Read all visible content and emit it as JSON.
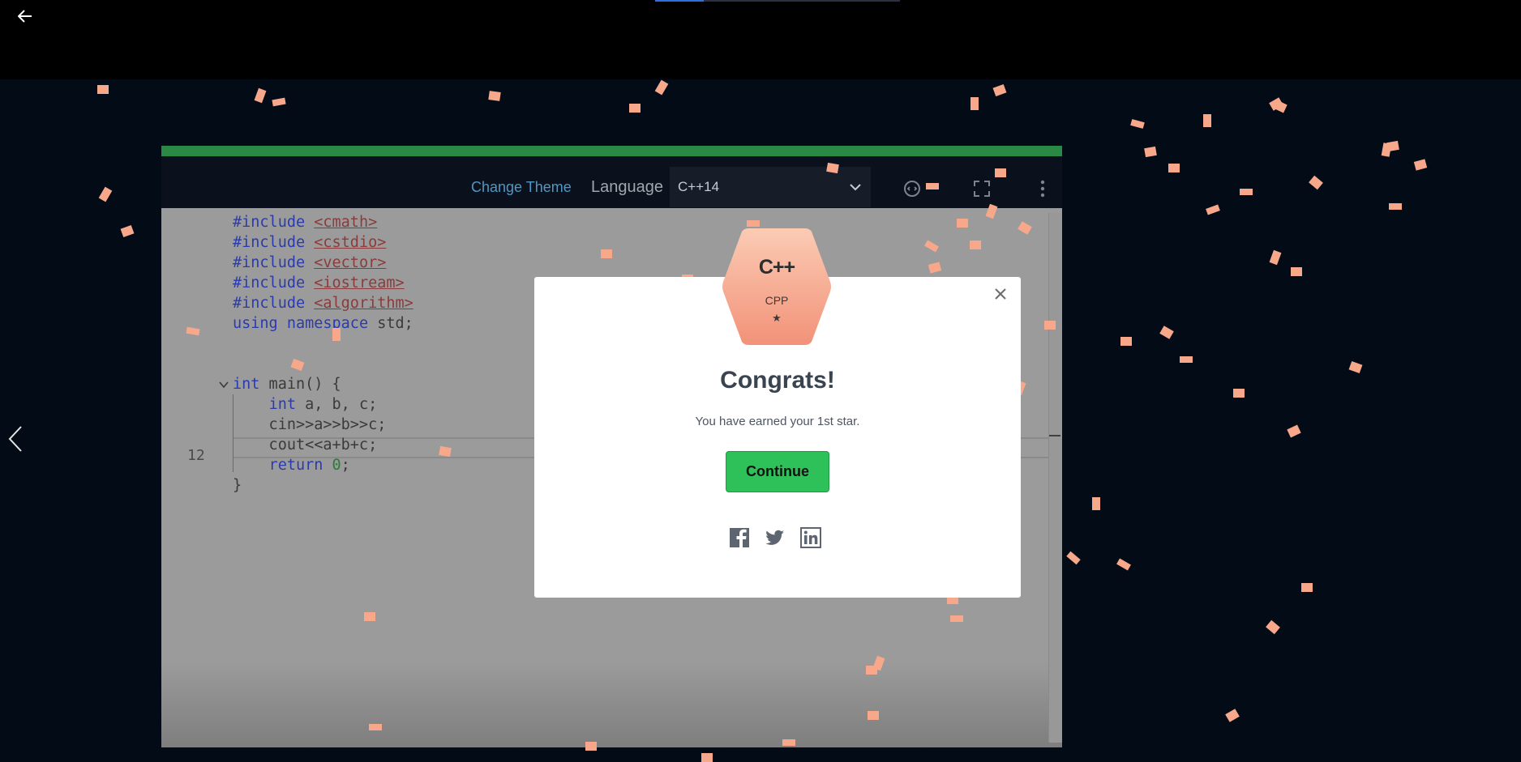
{
  "nav": {
    "back_icon": "arrow-left-icon",
    "prev_icon": "chevron-left-icon",
    "lesson_progress_fraction": 0.2
  },
  "toolbar": {
    "change_theme": "Change Theme",
    "language_label": "Language",
    "language_value": "C++14",
    "icons": [
      "reset-icon",
      "fullscreen-icon",
      "more-vertical-icon"
    ]
  },
  "editor": {
    "current_line_number": "12",
    "code_lines": [
      "#include <cmath>",
      "#include <cstdio>",
      "#include <vector>",
      "#include <iostream>",
      "#include <algorithm>",
      "using namespace std;",
      "",
      "int main() {",
      "    int a, b, c;",
      "    cin>>a>>b>>c;",
      "    cout<<a+b+c;",
      "    return 0;",
      "}"
    ]
  },
  "dialog": {
    "badge_logo": "C++",
    "badge_name": "CPP",
    "badge_star": "★",
    "title": "Congrats!",
    "message": "You have earned your 1st star.",
    "continue_label": "Continue",
    "share_icons": [
      "facebook-icon",
      "twitter-icon",
      "linkedin-icon"
    ]
  },
  "colors": {
    "accent_green": "#2ec15a",
    "progress_blue": "#2f6fe0",
    "badge_orange": "#f5a489",
    "confetti": "#f7a88b"
  }
}
